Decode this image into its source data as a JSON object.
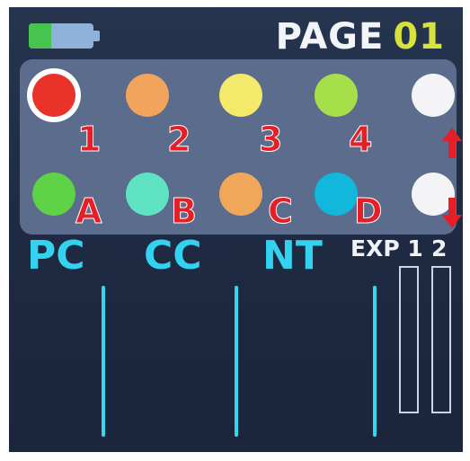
{
  "battery": {
    "icon": "battery-icon",
    "level": 0.35,
    "fill_color": "#46c44e",
    "case_color": "#8fb2da"
  },
  "header": {
    "page_word": "PAGE",
    "page_number": "01",
    "word_color": "#f2f4f8",
    "number_color": "#d8e23c"
  },
  "presets": {
    "top_row": [
      {
        "label": "1",
        "color": "#e8322a",
        "selected": true
      },
      {
        "label": "2",
        "color": "#f2a35c",
        "selected": false
      },
      {
        "label": "3",
        "color": "#f3ea6c",
        "selected": false
      },
      {
        "label": "4",
        "color": "#a6df4a",
        "selected": false
      },
      {
        "label": "",
        "color": "#f4f4f6",
        "selected": false,
        "icon": "arrow-up-icon"
      }
    ],
    "bottom_row": [
      {
        "label": "A",
        "color": "#5fd348",
        "selected": false
      },
      {
        "label": "B",
        "color": "#5fe3c2",
        "selected": false
      },
      {
        "label": "C",
        "color": "#f0a75a",
        "selected": false
      },
      {
        "label": "D",
        "color": "#12b8dc",
        "selected": false
      },
      {
        "label": "",
        "color": "#f4f4f6",
        "selected": false,
        "icon": "arrow-down-icon"
      }
    ],
    "label_color": "#e61e25"
  },
  "sections": {
    "pc_label": "PC",
    "cc_label": "CC",
    "nt_label": "NT",
    "exp_label": "EXP",
    "exp1_label": "1",
    "exp2_label": "2",
    "accent_color": "#33d3f0"
  },
  "exp_levels": {
    "exp1": 0,
    "exp2": 0
  }
}
